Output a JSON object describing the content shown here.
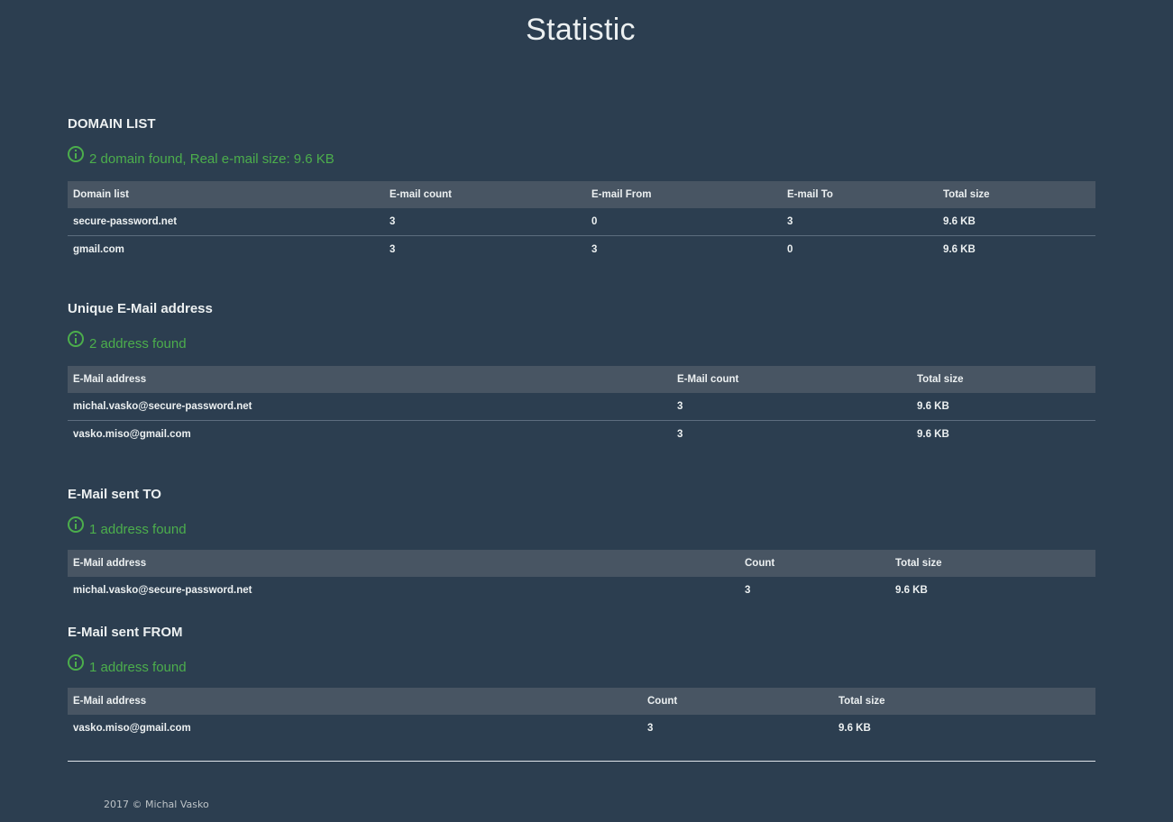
{
  "page": {
    "title": "Statistic"
  },
  "domain_list": {
    "heading": "DOMAIN LIST",
    "info": "2 domain found, Real e-mail size: 9.6 KB",
    "columns": [
      "Domain list",
      "E-mail count",
      "E-mail From",
      "E-mail To",
      "Total size"
    ],
    "rows": [
      [
        "secure-password.net",
        "3",
        "0",
        "3",
        "9.6 KB"
      ],
      [
        "gmail.com",
        "3",
        "3",
        "0",
        "9.6 KB"
      ]
    ]
  },
  "unique_addresses": {
    "heading": "Unique E-Mail address",
    "info": "2 address found",
    "columns": [
      "E-Mail address",
      "E-Mail count",
      "Total size"
    ],
    "rows": [
      [
        "michal.vasko@secure-password.net",
        "3",
        "9.6 KB"
      ],
      [
        "vasko.miso@gmail.com",
        "3",
        "9.6 KB"
      ]
    ]
  },
  "sent_to": {
    "heading": "E-Mail sent TO",
    "info": "1 address found",
    "columns": [
      "E-Mail address",
      "Count",
      "Total size"
    ],
    "rows": [
      [
        "michal.vasko@secure-password.net",
        "3",
        "9.6 KB"
      ]
    ]
  },
  "sent_from": {
    "heading": "E-Mail sent FROM",
    "info": "1 address found",
    "columns": [
      "E-Mail address",
      "Count",
      "Total size"
    ],
    "rows": [
      [
        "vasko.miso@gmail.com",
        "3",
        "9.6 KB"
      ]
    ]
  },
  "footer": {
    "text": "2017 © Michal Vasko"
  },
  "colors": {
    "background": "#2c3e50",
    "table_header": "#485563",
    "info_green": "#4cae4c",
    "text": "#ecf0f1"
  },
  "icons": {
    "info": "info-circle-icon"
  }
}
